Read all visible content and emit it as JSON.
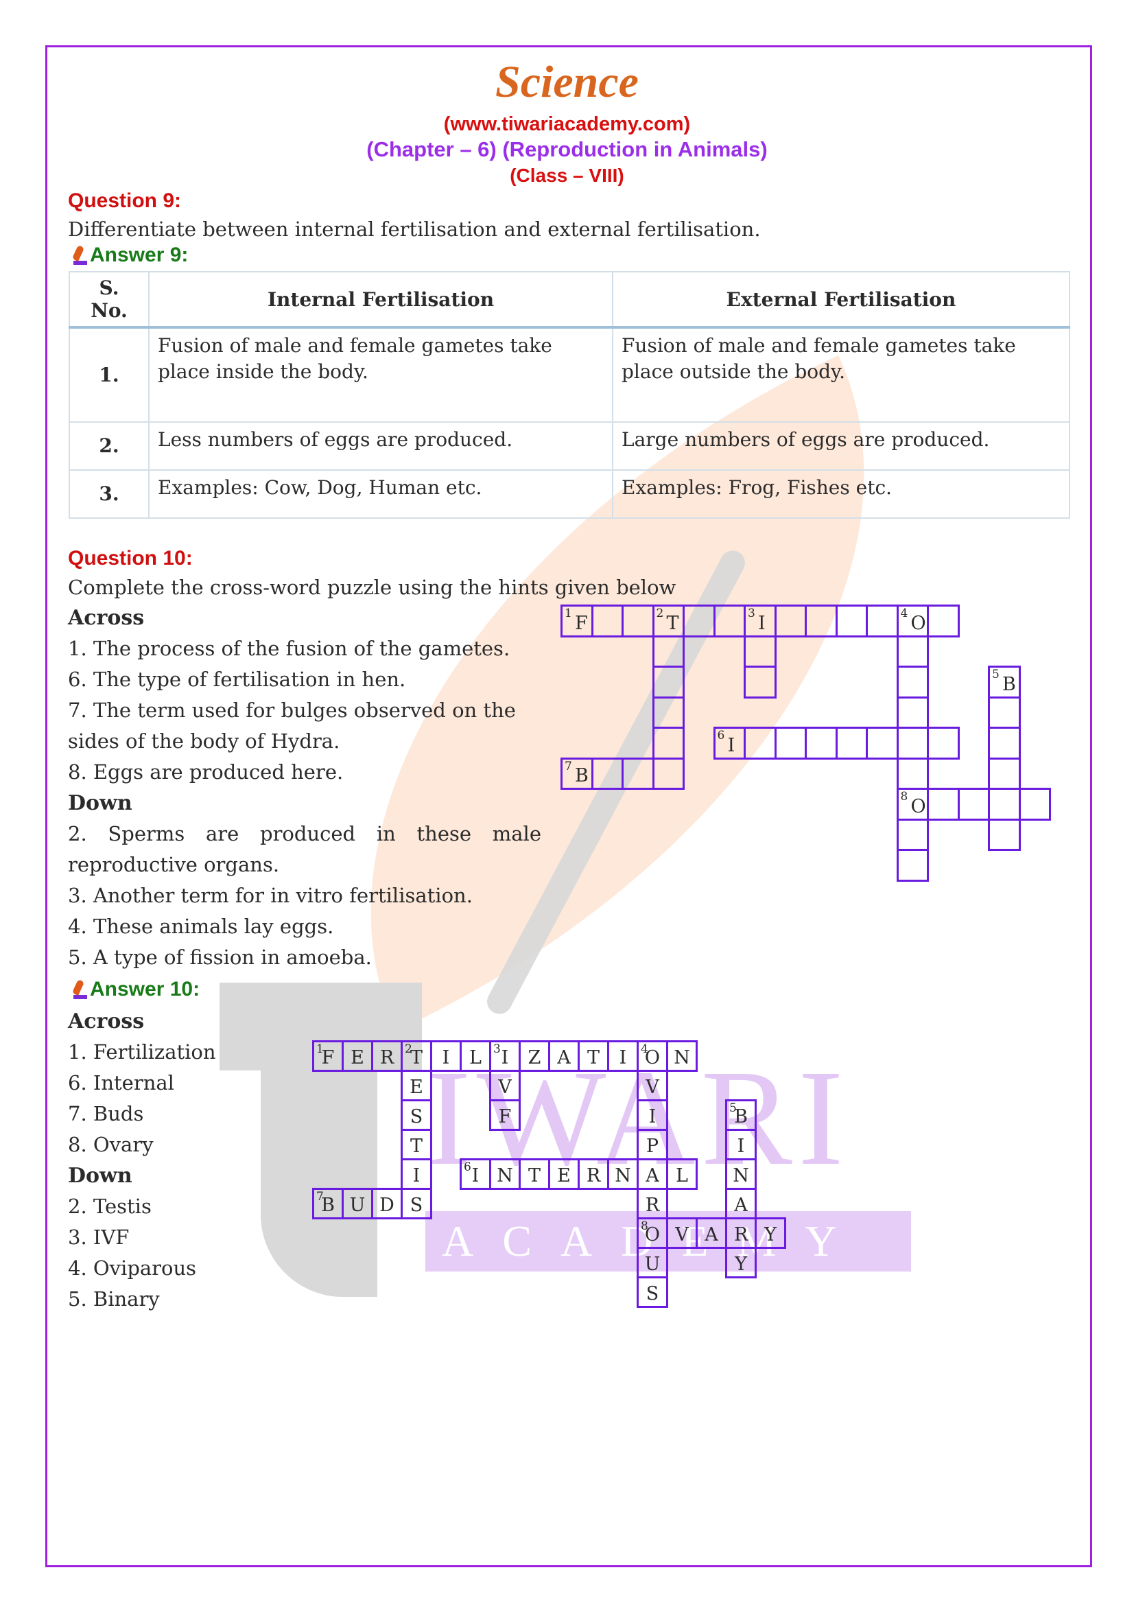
{
  "header": {
    "title": "Science",
    "website": "(www.tiwariacademy.com)",
    "chapter": "(Chapter – 6) (Reproduction in Animals)",
    "class": "(Class – VIII)"
  },
  "colors": {
    "frame": "#a020e0",
    "title": "#d9661f",
    "question": "#d01010",
    "answer": "#187a18",
    "chapter": "#9b2ee8",
    "grid": "#6a1be0"
  },
  "q9": {
    "label": "Question 9:",
    "text": "Differentiate between internal fertilisation and external fertilisation.",
    "answer_label": "Answer 9:",
    "table": {
      "headers": [
        "S. No.",
        "Internal Fertilisation",
        "External Fertilisation"
      ],
      "rows": [
        [
          "1.",
          "Fusion of male and female gametes take place inside the body.",
          "Fusion of male and female gametes take place outside the body."
        ],
        [
          "2.",
          "Less numbers of eggs are produced.",
          "Large numbers of eggs are produced."
        ],
        [
          "3.",
          "Examples: Cow, Dog, Human etc.",
          "Examples: Frog, Fishes etc."
        ]
      ]
    }
  },
  "q10": {
    "label": "Question 10:",
    "text": "Complete the cross-word puzzle using the hints given below",
    "across_label": "Across",
    "across": [
      "1. The process of the fusion of the gametes.",
      "6. The type of fertilisation in hen.",
      "7. The term used for bulges observed on the sides of the body of Hydra.",
      "8. Eggs are produced here."
    ],
    "down_label": "Down",
    "down": [
      "2. Sperms are produced in these male reproductive organs.",
      "3. Another term for in vitro fertilisation.",
      "4. These animals lay eggs.",
      "5. A type of fission in amoeba."
    ],
    "answer_label": "Answer 10:",
    "answers_across_label": "Across",
    "answers_across": [
      "1. Fertilization",
      "6. Internal",
      "7. Buds",
      "8. Ovary"
    ],
    "answers_down_label": "Down",
    "answers_down": [
      "2. Testis",
      "3. IVF",
      "4. Oviparous",
      "5. Binary"
    ],
    "puzzle_words": [
      {
        "num": "1",
        "dir": "across",
        "row": 0,
        "col": 0,
        "word": "FERTILIZATION",
        "hint_letter": "F"
      },
      {
        "num": "2",
        "dir": "down",
        "row": 0,
        "col": 3,
        "word": "TESTIS",
        "hint_letter": "T"
      },
      {
        "num": "3",
        "dir": "down",
        "row": 0,
        "col": 6,
        "word": "IVF",
        "hint_letter": "I"
      },
      {
        "num": "4",
        "dir": "down",
        "row": 0,
        "col": 11,
        "word": "OVIPAROUS",
        "hint_letter": "O"
      },
      {
        "num": "5",
        "dir": "down",
        "row": 2,
        "col": 14,
        "word": "BINARY",
        "hint_letter": "B"
      },
      {
        "num": "6",
        "dir": "across",
        "row": 4,
        "col": 5,
        "word": "INTERNAL",
        "hint_letter": "I"
      },
      {
        "num": "7",
        "dir": "across",
        "row": 5,
        "col": 0,
        "word": "BUDS",
        "hint_letter": "B"
      },
      {
        "num": "8",
        "dir": "across",
        "row": 6,
        "col": 11,
        "word": "OVARY",
        "hint_letter": "O"
      }
    ],
    "question_grid_words": [
      {
        "num": "1",
        "dir": "across",
        "row": 0,
        "col": 0,
        "len": 13,
        "hint_letter": "F"
      },
      {
        "num": "2",
        "dir": "down",
        "row": 0,
        "col": 3,
        "len": 6,
        "hint_letter": "T"
      },
      {
        "num": "3",
        "dir": "down",
        "row": 0,
        "col": 6,
        "len": 3,
        "hint_letter": "I"
      },
      {
        "num": "4",
        "dir": "down",
        "row": 0,
        "col": 11,
        "len": 9,
        "hint_letter": "O"
      },
      {
        "num": "5",
        "dir": "down",
        "row": 2,
        "col": 14,
        "len": 6,
        "hint_letter": "B"
      },
      {
        "num": "6",
        "dir": "across",
        "row": 4,
        "col": 5,
        "len": 8,
        "hint_letter": "I"
      },
      {
        "num": "7",
        "dir": "across",
        "row": 5,
        "col": 0,
        "len": 4,
        "hint_letter": "B"
      },
      {
        "num": "8",
        "dir": "across",
        "row": 6,
        "col": 11,
        "len": 5,
        "hint_letter": "O"
      }
    ]
  },
  "watermark": {
    "word1": "IWARI",
    "word2": "ACADEMY"
  }
}
